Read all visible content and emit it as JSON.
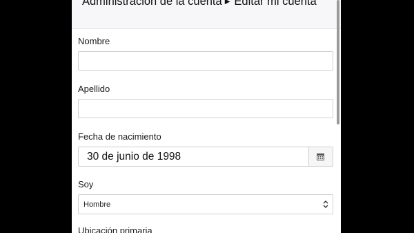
{
  "breadcrumb": {
    "parent": "Administración de la cuenta",
    "current": "Editar mi cuenta"
  },
  "form": {
    "nombre": {
      "label": "Nombre",
      "value": ""
    },
    "apellido": {
      "label": "Apellido",
      "value": ""
    },
    "fecha": {
      "label": "Fecha de nacimiento",
      "value": "30 de junio de 1998"
    },
    "soy": {
      "label": "Soy",
      "value": "Hombre"
    },
    "ubicacion": {
      "label": "Ubicación primaria"
    }
  },
  "icons": {
    "arrow": "caret-right-icon",
    "calendar": "calendar-icon",
    "select": "chevron-updown-icon"
  }
}
